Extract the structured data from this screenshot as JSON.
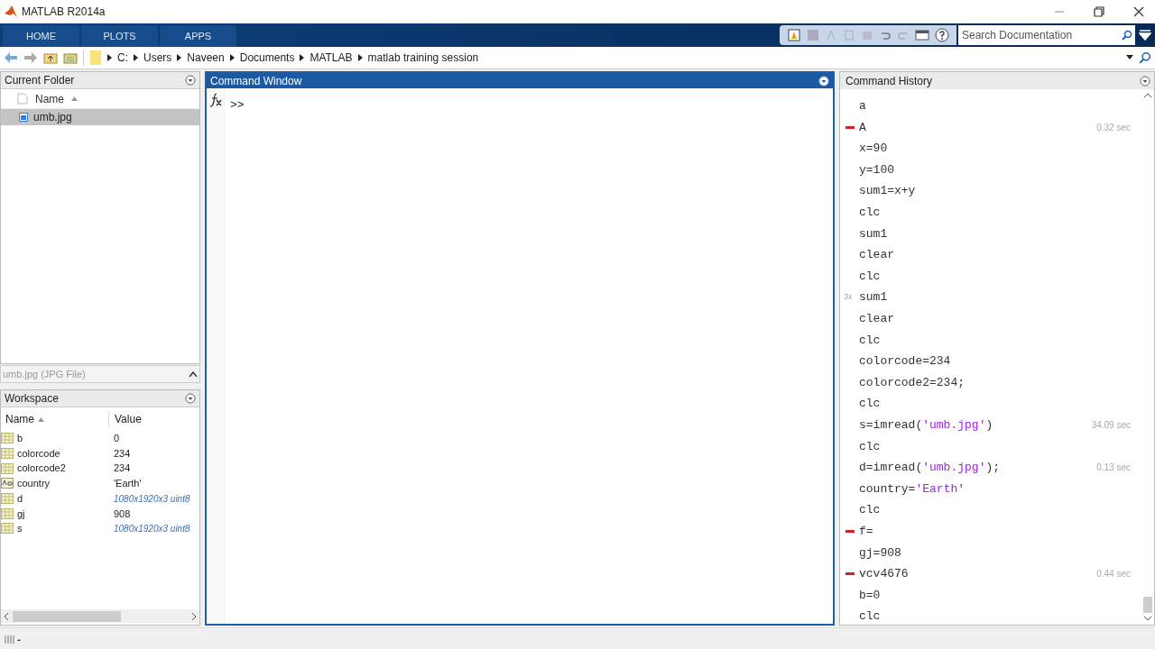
{
  "window": {
    "title": "MATLAB R2014a"
  },
  "tabs": [
    {
      "label": "HOME",
      "selected": false
    },
    {
      "label": "PLOTS",
      "selected": false
    },
    {
      "label": "APPS",
      "selected": false
    }
  ],
  "search": {
    "placeholder": "Search Documentation"
  },
  "path": [
    "C:",
    "Users",
    "Naveen",
    "Documents",
    "MATLAB",
    "matlab training session"
  ],
  "current_folder": {
    "title": "Current Folder",
    "column": "Name",
    "files": [
      {
        "name": "umb.jpg",
        "selected": true
      }
    ],
    "details": "umb.jpg (JPG File)"
  },
  "workspace": {
    "title": "Workspace",
    "columns": [
      "Name",
      "Value"
    ],
    "variables": [
      {
        "name": "b",
        "value": "0",
        "kind": "numeric"
      },
      {
        "name": "colorcode",
        "value": "234",
        "kind": "numeric"
      },
      {
        "name": "colorcode2",
        "value": "234",
        "kind": "numeric"
      },
      {
        "name": "country",
        "value": "'Earth'",
        "kind": "char"
      },
      {
        "name": "d",
        "value": "1080x1920x3 uint8",
        "kind": "array"
      },
      {
        "name": "gj",
        "value": "908",
        "kind": "numeric"
      },
      {
        "name": "s",
        "value": "1080x1920x3 uint8",
        "kind": "array"
      }
    ]
  },
  "command_window": {
    "title": "Command Window",
    "prompt": ">>"
  },
  "command_history": {
    "title": "Command History",
    "entries": [
      {
        "parts": [
          {
            "text": "a",
            "kind": "code"
          }
        ],
        "error": false
      },
      {
        "parts": [
          {
            "text": "A",
            "kind": "code"
          }
        ],
        "error": true,
        "time": "0.32 sec"
      },
      {
        "parts": [
          {
            "text": "x=90",
            "kind": "code"
          }
        ],
        "error": false
      },
      {
        "parts": [
          {
            "text": "y=100",
            "kind": "code"
          }
        ],
        "error": false
      },
      {
        "parts": [
          {
            "text": "sum1=x+y",
            "kind": "code"
          }
        ],
        "error": false
      },
      {
        "parts": [
          {
            "text": "clc",
            "kind": "code"
          }
        ],
        "error": false
      },
      {
        "parts": [
          {
            "text": "sum1",
            "kind": "code"
          }
        ],
        "error": false
      },
      {
        "parts": [
          {
            "text": "clear",
            "kind": "code"
          }
        ],
        "error": false
      },
      {
        "parts": [
          {
            "text": "clc",
            "kind": "code"
          }
        ],
        "error": false
      },
      {
        "parts": [
          {
            "text": "sum1",
            "kind": "code"
          }
        ],
        "error": false,
        "count": "3x"
      },
      {
        "parts": [
          {
            "text": "clear",
            "kind": "code"
          }
        ],
        "error": false
      },
      {
        "parts": [
          {
            "text": "clc",
            "kind": "code"
          }
        ],
        "error": false
      },
      {
        "parts": [
          {
            "text": "colorcode=234",
            "kind": "code"
          }
        ],
        "error": false
      },
      {
        "parts": [
          {
            "text": "colorcode2=234;",
            "kind": "code"
          }
        ],
        "error": false
      },
      {
        "parts": [
          {
            "text": "clc",
            "kind": "code"
          }
        ],
        "error": false
      },
      {
        "parts": [
          {
            "text": "s=imread(",
            "kind": "code"
          },
          {
            "text": "'umb.jpg'",
            "kind": "string"
          },
          {
            "text": ")",
            "kind": "code"
          }
        ],
        "error": false,
        "time": "34.09 sec"
      },
      {
        "parts": [
          {
            "text": "clc",
            "kind": "code"
          }
        ],
        "error": false
      },
      {
        "parts": [
          {
            "text": "d=imread(",
            "kind": "code"
          },
          {
            "text": "'umb.jpg'",
            "kind": "string"
          },
          {
            "text": ");",
            "kind": "code"
          }
        ],
        "error": false,
        "time": "0.13 sec"
      },
      {
        "parts": [
          {
            "text": "country=",
            "kind": "code"
          },
          {
            "text": "'Earth'",
            "kind": "string"
          }
        ],
        "error": false
      },
      {
        "parts": [
          {
            "text": "clc",
            "kind": "code"
          }
        ],
        "error": false
      },
      {
        "parts": [
          {
            "text": "f=",
            "kind": "code"
          }
        ],
        "error": true
      },
      {
        "parts": [
          {
            "text": "gj=908",
            "kind": "code"
          }
        ],
        "error": false
      },
      {
        "parts": [
          {
            "text": "vcv4676",
            "kind": "code"
          }
        ],
        "error": true,
        "time": "0.44 sec"
      },
      {
        "parts": [
          {
            "text": "b=0",
            "kind": "code"
          }
        ],
        "error": false
      },
      {
        "parts": [
          {
            "text": "clc",
            "kind": "code"
          }
        ],
        "error": false
      }
    ]
  }
}
